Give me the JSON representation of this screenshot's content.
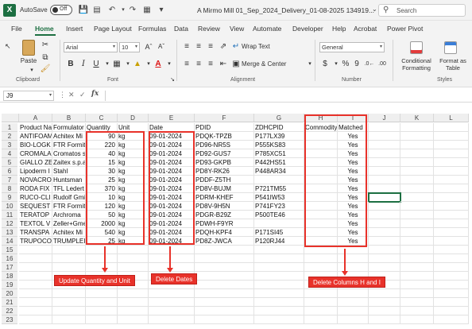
{
  "titlebar": {
    "logo": "X",
    "autosave_label": "AutoSave",
    "autosave_state": "Off",
    "window_title": "A Mirmo Mill 01_Sep_2024_Delivery_01-08-2025 134919...",
    "search_placeholder": "Search"
  },
  "menu": {
    "tabs": [
      "File",
      "Home",
      "Insert",
      "Page Layout",
      "Formulas",
      "Data",
      "Review",
      "View",
      "Automate",
      "Developer",
      "Help",
      "Acrobat",
      "Power Pivot"
    ],
    "active_tab": "Home"
  },
  "ribbon": {
    "clipboard": {
      "paste_label": "Paste",
      "group_label": "Clipboard"
    },
    "font": {
      "font_name": "Arial",
      "font_size": "10",
      "group_label": "Font",
      "bold": "B",
      "italic": "I",
      "underline": "U"
    },
    "alignment": {
      "wrap_text": "Wrap Text",
      "merge_center": "Merge & Center",
      "group_label": "Alignment"
    },
    "number": {
      "format": "General",
      "currency": "$",
      "percent": "%",
      "comma": "9",
      "group_label": "Number"
    },
    "styles": {
      "conditional_formatting": "Conditional Formatting",
      "format_as_table": "Format as Table",
      "group_label": "Styles"
    }
  },
  "formula_bar": {
    "name_box": "J9",
    "fx": "fx",
    "formula": ""
  },
  "sheet": {
    "columns": [
      "A",
      "B",
      "C",
      "D",
      "E",
      "F",
      "G",
      "H",
      "I",
      "J",
      "K",
      "L"
    ],
    "rows": [
      {
        "n": "1",
        "A": "Product Na",
        "B": "Formulator",
        "C": "Quantity",
        "D": "Unit",
        "E": "Date",
        "F": "PDID",
        "G": "ZDHCPID",
        "H": "Commodity",
        "I": "Matched"
      },
      {
        "n": "2",
        "A": "ANTIFOAM",
        "B": "Achitex Mi",
        "C": "90",
        "D": "kg",
        "E": "09-01-2024",
        "F": "PDQK-TPZB",
        "G": "P177LX39",
        "H": "",
        "I": "Yes"
      },
      {
        "n": "3",
        "A": "BIO-LOGK",
        "B": "FTR Formit",
        "C": "220",
        "D": "kg",
        "E": "09-01-2024",
        "F": "PD96-NR5S",
        "G": "P555KS83",
        "H": "",
        "I": "Yes"
      },
      {
        "n": "4",
        "A": "CROMALA",
        "B": "Cromatos s",
        "C": "40",
        "D": "kg",
        "E": "09-01-2024",
        "F": "PD92-GUS7",
        "G": "P785XC51",
        "H": "",
        "I": "Yes"
      },
      {
        "n": "5",
        "A": "GIALLO ZE",
        "B": "Zaitex s.p.a",
        "C": "15",
        "D": "kg",
        "E": "09-01-2024",
        "F": "PD93-GKPB",
        "G": "P442HS51",
        "H": "",
        "I": "Yes"
      },
      {
        "n": "6",
        "A": "Lipoderm I",
        "B": "Stahl",
        "C": "30",
        "D": "kg",
        "E": "09-01-2024",
        "F": "PD8Y-RK26",
        "G": "P448AR34",
        "H": "",
        "I": "Yes"
      },
      {
        "n": "7",
        "A": "NOVACRO",
        "B": "Huntsman",
        "C": "25",
        "D": "kg",
        "E": "09-01-2024",
        "F": "PDDF-Z5TH",
        "G": "",
        "H": "",
        "I": "Yes"
      },
      {
        "n": "8",
        "A": "RODA FIX",
        "B": "TFL Ledert",
        "C": "370",
        "D": "kg",
        "E": "09-01-2024",
        "F": "PD8V-BUJM",
        "G": "P721TM55",
        "H": "",
        "I": "Yes"
      },
      {
        "n": "9",
        "A": "RUCO-CLI",
        "B": "Rudolf Gmi",
        "C": "10",
        "D": "kg",
        "E": "09-01-2024",
        "F": "PDRM-KHEF",
        "G": "P541IW53",
        "H": "",
        "I": "Yes"
      },
      {
        "n": "10",
        "A": "SEQUEST",
        "B": "FTR Formit",
        "C": "120",
        "D": "kg",
        "E": "09-01-2024",
        "F": "PD8V-9H5N",
        "G": "P741FY23",
        "H": "",
        "I": "Yes"
      },
      {
        "n": "11",
        "A": "TERATOP",
        "B": "Archroma",
        "C": "50",
        "D": "kg",
        "E": "09-01-2024",
        "F": "PDGR-B29Z",
        "G": "P500TE46",
        "H": "",
        "I": "Yes"
      },
      {
        "n": "12",
        "A": "TEXTOL V",
        "B": "Zeller+Gme",
        "C": "2000",
        "D": "kg",
        "E": "09-01-2024",
        "F": "PDWH-F9YR",
        "G": "",
        "H": "",
        "I": "Yes"
      },
      {
        "n": "13",
        "A": "TRANSPA",
        "B": "Achitex Mi",
        "C": "540",
        "D": "kg",
        "E": "09-01-2024",
        "F": "PDQH-KPF4",
        "G": "P171SI45",
        "H": "",
        "I": "Yes"
      },
      {
        "n": "14",
        "A": "TRUPOCO",
        "B": "TRUMPLEI",
        "C": "25",
        "D": "kg",
        "E": "09-01-2024",
        "F": "PD8Z-JWCA",
        "G": "P120RJ44",
        "H": "",
        "I": "Yes"
      },
      {
        "n": "15"
      },
      {
        "n": "16"
      },
      {
        "n": "17"
      },
      {
        "n": "18"
      },
      {
        "n": "19"
      },
      {
        "n": "20"
      },
      {
        "n": "21"
      },
      {
        "n": "22"
      },
      {
        "n": "23"
      }
    ]
  },
  "annotations": {
    "quantity_note": "Update Quantity and Unit",
    "dates_note": "Delete Dates",
    "columns_note": "Delete Columns H and I"
  },
  "colors": {
    "excel_green": "#1d6f42",
    "annotation_red": "#e8322a"
  }
}
